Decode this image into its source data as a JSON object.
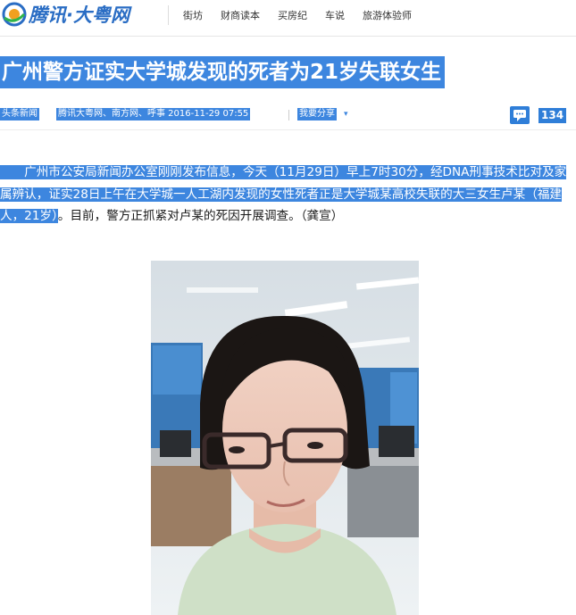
{
  "header": {
    "logo_text": "腾讯·大粤网",
    "nav": [
      "街坊",
      "财商读本",
      "买房纪",
      "车说",
      "旅游体验师"
    ]
  },
  "article": {
    "title": "广州警方证实大学城发现的死者为21岁失联女生",
    "category": "头条新闻",
    "source_line": "腾讯大粤网、南方网、呼事 2016-11-29 07:55",
    "share_label": "我要分享",
    "comment_count": "134",
    "body_highlighted": "　　广州市公安局新闻办公室刚刚发布信息，今天（11月29日）早上7时30分，经DNA刑事技术比对及家属辨认，证实28日上午在大学城一人工湖内发现的女性死者正是大学城某高校失联的大三女生卢某（福建人，21岁）",
    "body_plain": "。目前，警方正抓紧对卢某的死因开展调查。（龚宣）"
  },
  "colors": {
    "highlight": "#3d86df",
    "brand": "#2a6dc4"
  },
  "icons": {
    "logo": "tencent-logo-icon",
    "share": "share-caret-icon",
    "comment": "comment-icon"
  }
}
